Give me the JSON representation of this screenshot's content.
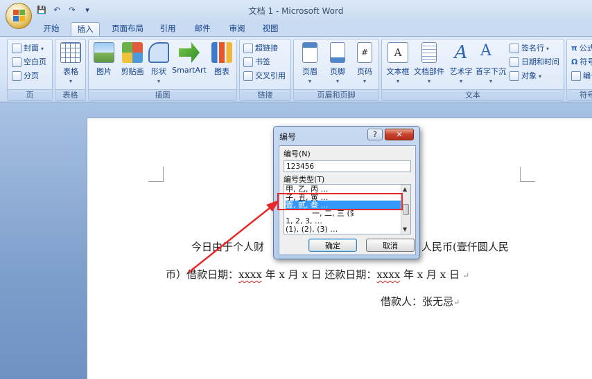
{
  "window": {
    "title": "文档 1 - Microsoft Word",
    "qat": {
      "save": "💾",
      "undo": "↶",
      "redo": "↷",
      "more": "▾"
    }
  },
  "tabs": [
    {
      "label": "开始",
      "active": false
    },
    {
      "label": "插入",
      "active": true
    },
    {
      "label": "页面布局",
      "active": false
    },
    {
      "label": "引用",
      "active": false
    },
    {
      "label": "邮件",
      "active": false
    },
    {
      "label": "审阅",
      "active": false
    },
    {
      "label": "视图",
      "active": false
    }
  ],
  "ribbon": {
    "pages": {
      "label": "页",
      "items": [
        "封面",
        "空白页",
        "分页"
      ]
    },
    "tables": {
      "label": "表格",
      "button": "表格"
    },
    "illustrations": {
      "label": "插图",
      "buttons": [
        "图片",
        "剪贴画",
        "形状",
        "SmartArt",
        "图表"
      ]
    },
    "links": {
      "label": "链接",
      "items": [
        "超链接",
        "书签",
        "交叉引用"
      ]
    },
    "header_footer": {
      "label": "页眉和页脚",
      "buttons": [
        "页眉",
        "页脚",
        "页码"
      ]
    },
    "text": {
      "label": "文本",
      "buttons": [
        "文本框",
        "文档部件",
        "艺术字",
        "首字下沉"
      ],
      "items": [
        "签名行",
        "日期和时间",
        "对象"
      ]
    },
    "symbols": {
      "label": "符号",
      "items": [
        "公式",
        "符号",
        "编号"
      ]
    }
  },
  "document": {
    "line1_left": "今日由于个人财",
    "line1_right": "人民币(壹仟圆人民",
    "line2_a": "币）借款日期：",
    "line2_x1": "xxxx",
    "line2_b": "年 x 月 x 日 还款日期：",
    "line2_x2": "xxxx",
    "line2_c": "年 x 月 x 日",
    "line3": "借款人：张无忌",
    "para_mark": "↵"
  },
  "dialog": {
    "title": "编号",
    "help": "?",
    "close": "✕",
    "number_label": "编号(N)",
    "number_value": "123456",
    "type_label": "编号类型(T)",
    "types": [
      "甲, 乙, 丙 …",
      "子, 丑, 寅 …",
      "壹, 贰, 叁 …",
      "一, 二, 三 (简)…",
      "1, 2, 3, …",
      "(1), (2), (3) …"
    ],
    "selected_index": 2,
    "ok": "确定",
    "cancel": "取消"
  },
  "colors": {
    "accent": "#3399ff",
    "annotation": "#e8282b"
  }
}
